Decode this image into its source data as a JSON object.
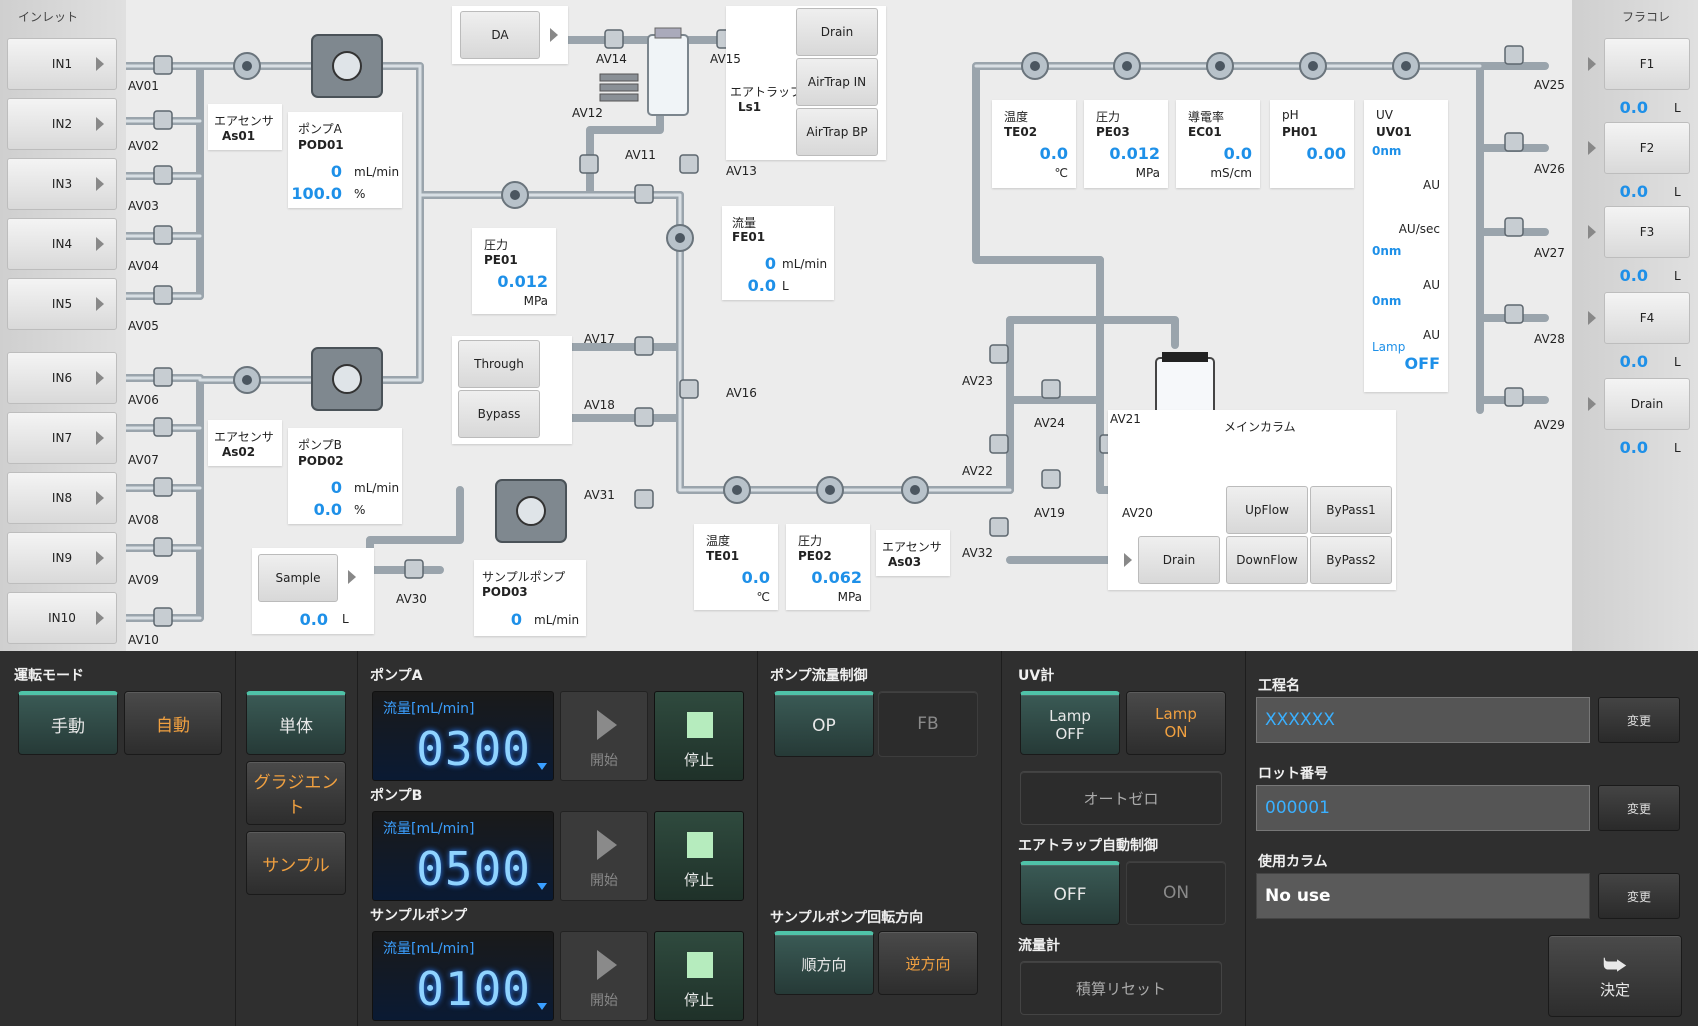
{
  "inlet": {
    "title": "インレット",
    "buttons": [
      "IN1",
      "IN2",
      "IN3",
      "IN4",
      "IN5",
      "IN6",
      "IN7",
      "IN8",
      "IN9",
      "IN10"
    ],
    "valves": [
      "AV01",
      "AV02",
      "AV03",
      "AV04",
      "AV05",
      "AV06",
      "AV07",
      "AV08",
      "AV09",
      "AV10"
    ]
  },
  "fraction": {
    "title": "フラコレ",
    "items": [
      {
        "label": "F1",
        "value": "0.0",
        "unit": "L",
        "valve": "AV25"
      },
      {
        "label": "F2",
        "value": "0.0",
        "unit": "L",
        "valve": "AV26"
      },
      {
        "label": "F3",
        "value": "0.0",
        "unit": "L",
        "valve": "AV27"
      },
      {
        "label": "F4",
        "value": "0.0",
        "unit": "L",
        "valve": "AV28"
      },
      {
        "label": "Drain",
        "value": "0.0",
        "unit": "L",
        "valve": "AV29"
      }
    ]
  },
  "air_sensor_1": {
    "title": "エアセンサ",
    "id": "As01"
  },
  "air_sensor_2": {
    "title": "エアセンサ",
    "id": "As02"
  },
  "air_sensor_3": {
    "title": "エアセンサ",
    "id": "As03"
  },
  "pump_a": {
    "title": "ポンプA",
    "id": "POD01",
    "flow": "0",
    "flow_unit": "mL/min",
    "pct": "100.0",
    "pct_unit": "%"
  },
  "pump_b": {
    "title": "ポンプB",
    "id": "POD02",
    "flow": "0",
    "flow_unit": "mL/min",
    "pct": "0.0",
    "pct_unit": "%"
  },
  "sample_pump": {
    "title": "サンプルポンプ",
    "id": "POD03",
    "flow": "0",
    "flow_unit": "mL/min"
  },
  "sample": {
    "label": "Sample",
    "value": "0.0",
    "unit": "L",
    "valve": "AV30"
  },
  "pressure_pe01": {
    "title": "圧力",
    "id": "PE01",
    "value": "0.012",
    "unit": "MPa"
  },
  "flow_fe01": {
    "title": "流量",
    "id": "FE01",
    "flow": "0",
    "flow_unit": "mL/min",
    "total": "0.0",
    "total_unit": "L"
  },
  "temp_te01": {
    "title": "温度",
    "id": "TE01",
    "value": "0.0",
    "unit": "℃"
  },
  "pressure_pe02": {
    "title": "圧力",
    "id": "PE02",
    "value": "0.062",
    "unit": "MPa"
  },
  "temp_te02": {
    "title": "温度",
    "id": "TE02",
    "value": "0.0",
    "unit": "℃"
  },
  "pressure_pe03": {
    "title": "圧力",
    "id": "PE03",
    "value": "0.012",
    "unit": "MPa"
  },
  "cond_ec01": {
    "title": "導電率",
    "id": "EC01",
    "value": "0.0",
    "unit": "mS/cm"
  },
  "ph_ph01": {
    "title": "pH",
    "id": "PH01",
    "value": "0.00"
  },
  "uv_uv01": {
    "title": "UV",
    "id": "UV01",
    "wl1": "0nm",
    "unit1": "AU",
    "unit2": "AU/sec",
    "wl2": "0nm",
    "unit3": "AU",
    "wl3": "0nm",
    "unit4": "AU",
    "lamp_label": "Lamp",
    "lamp_state": "OFF"
  },
  "air_trap": {
    "title": "エアトラップ",
    "id": "Ls1",
    "btn_drain": "Drain",
    "btn_in": "AirTrap IN",
    "btn_bp": "AirTrap BP"
  },
  "da": {
    "label": "DA"
  },
  "through_bypass": {
    "through": "Through",
    "bypass": "Bypass"
  },
  "main_column": {
    "title": "メインカラム",
    "upflow": "UpFlow",
    "bypass1": "ByPass1",
    "downflow": "DownFlow",
    "bypass2": "ByPass2",
    "drain": "Drain"
  },
  "valve_labels": {
    "av11": "AV11",
    "av12": "AV12",
    "av13": "AV13",
    "av14": "AV14",
    "av15": "AV15",
    "av16": "AV16",
    "av17": "AV17",
    "av18": "AV18",
    "av19": "AV19",
    "av20": "AV20",
    "av21": "AV21",
    "av22": "AV22",
    "av23": "AV23",
    "av24": "AV24",
    "av31": "AV31",
    "av32": "AV32"
  },
  "control": {
    "mode": {
      "title": "運転モード",
      "manual": "手動",
      "auto": "自動"
    },
    "pattern": {
      "single": "単体",
      "gradient": "グラジエント",
      "sample": "サンプル"
    },
    "pump_a": {
      "title": "ポンプA",
      "flow_label": "流量[mL/min]",
      "value": "0300",
      "start": "開始",
      "stop": "停止"
    },
    "pump_b": {
      "title": "ポンプB",
      "flow_label": "流量[mL/min]",
      "value": "0500",
      "start": "開始",
      "stop": "停止"
    },
    "sample_pump": {
      "title": "サンプルポンプ",
      "flow_label": "流量[mL/min]",
      "value": "0100",
      "start": "開始",
      "stop": "停止"
    },
    "flow_ctrl": {
      "title": "ポンプ流量制御",
      "op": "OP",
      "fb": "FB"
    },
    "rotation": {
      "title": "サンプルポンプ回転方向",
      "forward": "順方向",
      "reverse": "逆方向"
    },
    "uv": {
      "title": "UV計",
      "lamp_off": "Lamp\nOFF",
      "lamp_on": "Lamp\nON",
      "autozero": "オートゼロ"
    },
    "airtrap_ctrl": {
      "title": "エアトラップ自動制御",
      "off": "OFF",
      "on": "ON"
    },
    "flowmeter": {
      "title": "流量計",
      "reset": "積算リセット"
    },
    "process": {
      "title": "工程名",
      "value": "XXXXXX",
      "change": "変更"
    },
    "lot": {
      "title": "ロット番号",
      "value": "000001",
      "change": "変更"
    },
    "column": {
      "title": "使用カラム",
      "value": "No use",
      "change": "変更"
    },
    "decide": "決定"
  },
  "colors": {
    "accent": "#1e90e8",
    "active": "#4fc3a8",
    "orange": "#f0a040"
  }
}
